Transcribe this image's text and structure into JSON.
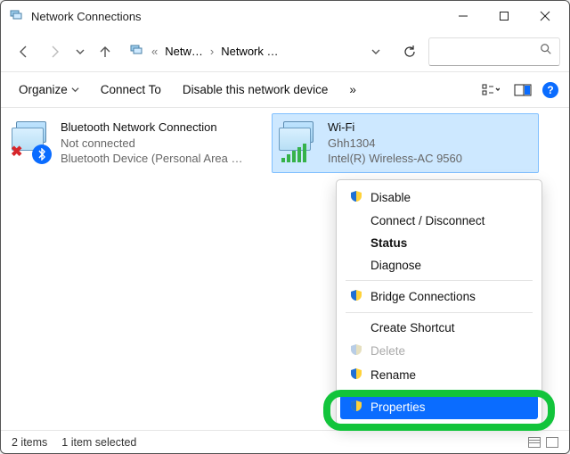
{
  "window": {
    "title": "Network Connections"
  },
  "address": {
    "seg1": "Netw…",
    "seg2": "Network …"
  },
  "toolbar": {
    "organize": "Organize",
    "connect_to": "Connect To",
    "disable_device": "Disable this network device",
    "overflow": "»"
  },
  "connections": [
    {
      "name": "Bluetooth Network Connection",
      "status": "Not connected",
      "device": "Bluetooth Device (Personal Area …"
    },
    {
      "name": "Wi-Fi",
      "status": "Ghh1304",
      "device": "Intel(R) Wireless-AC 9560"
    }
  ],
  "context_menu": {
    "disable": "Disable",
    "connect_disconnect": "Connect / Disconnect",
    "status": "Status",
    "diagnose": "Diagnose",
    "bridge": "Bridge Connections",
    "create_shortcut": "Create Shortcut",
    "delete": "Delete",
    "rename": "Rename",
    "properties": "Properties"
  },
  "statusbar": {
    "count": "2 items",
    "selected": "1 item selected"
  }
}
